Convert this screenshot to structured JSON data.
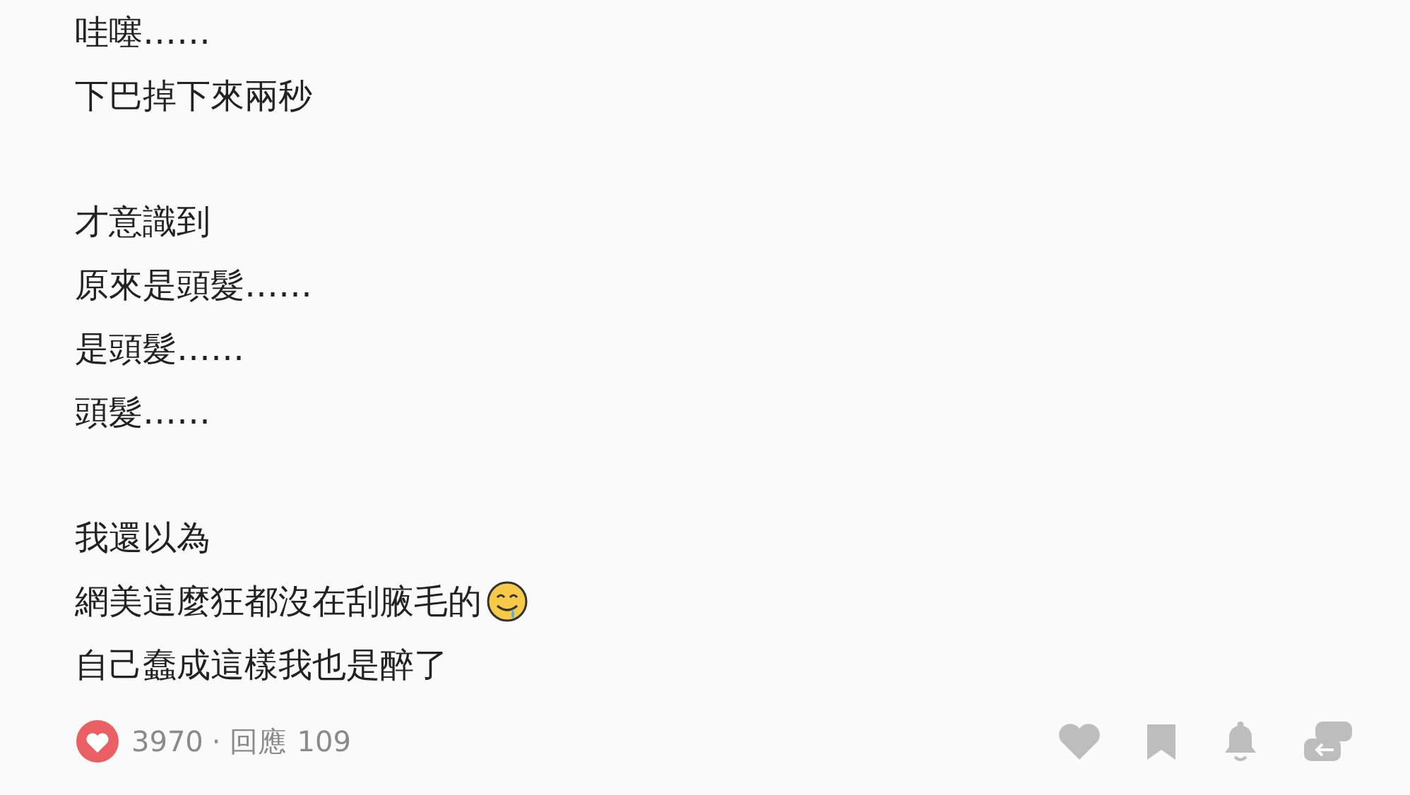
{
  "paragraphs": [
    {
      "lines": [
        {
          "text": "哇噻……",
          "emoji": false
        },
        {
          "text": "下巴掉下來兩秒",
          "emoji": false
        }
      ]
    },
    {
      "lines": [
        {
          "text": "才意識到",
          "emoji": false
        },
        {
          "text": "原來是頭髮……",
          "emoji": false
        },
        {
          "text": "是頭髮……",
          "emoji": false
        },
        {
          "text": "頭髮……",
          "emoji": false
        }
      ]
    },
    {
      "lines": [
        {
          "text": "我還以為",
          "emoji": false
        },
        {
          "text": "網美這麼狂都沒在刮腋毛的",
          "emoji": true
        },
        {
          "text": "自己蠢成這樣我也是醉了",
          "emoji": false
        }
      ]
    }
  ],
  "footer": {
    "likes": "3970",
    "separator": "·",
    "replies_label": "回應",
    "replies": "109"
  }
}
